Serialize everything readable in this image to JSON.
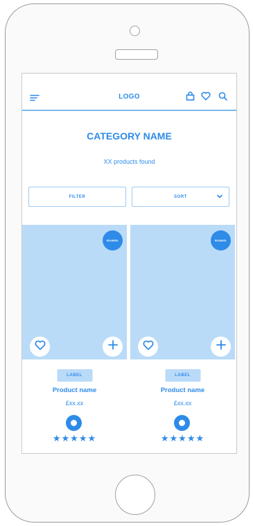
{
  "header": {
    "logo": "LOGO"
  },
  "category": {
    "title": "CATEGORY NAME",
    "count_text": "XX products found"
  },
  "controls": {
    "filter_label": "FILTER",
    "sort_label": "SORT"
  },
  "products": [
    {
      "badge": "ROUNDEL",
      "label": "LABEL",
      "name": "Product name",
      "price": "£xx.xx",
      "rating": 5
    },
    {
      "badge": "ROUNDEL",
      "label": "LABEL",
      "name": "Product name",
      "price": "£xx.xx",
      "rating": 5
    }
  ],
  "icons": {
    "menu": "menu-icon",
    "bag": "bag-icon",
    "wishlist": "heart-icon",
    "search": "search-icon",
    "sort_dropdown": "chevron-down-icon",
    "add": "plus-icon",
    "star": "star-icon"
  },
  "colors": {
    "accent": "#2e8be8",
    "image_placeholder": "#badbf8",
    "divider": "#7ab9ec"
  }
}
